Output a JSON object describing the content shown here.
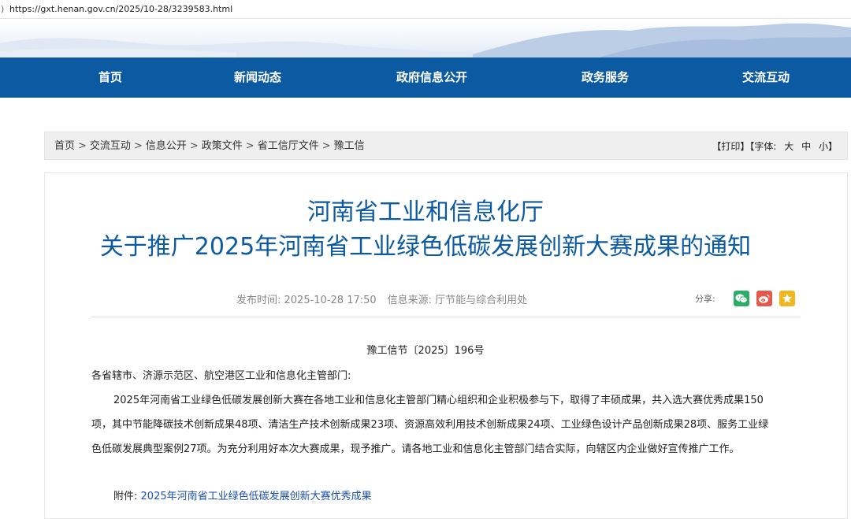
{
  "browser": {
    "url": "https://gxt.henan.gov.cn/2025/10-28/3239583.html"
  },
  "nav": {
    "items": [
      "首页",
      "新闻动态",
      "政府信息公开",
      "政务服务",
      "交流互动"
    ]
  },
  "breadcrumb": {
    "items": [
      "首页",
      "交流互动",
      "信息公开",
      "政策文件",
      "省工信厅文件",
      "豫工信"
    ],
    "separator": ">"
  },
  "tools": {
    "print_label": "【打印】",
    "font_label": "【字体:",
    "font_large": "大",
    "font_medium": "中",
    "font_small": "小",
    "font_close": "】"
  },
  "article": {
    "title_line1": "河南省工业和信息化厅",
    "title_line2": "关于推广2025年河南省工业绿色低碳发展创新大赛成果的通知",
    "publish_time": "发布时间: 2025-10-28 17:50",
    "source": "信息来源: 厅节能与综合利用处",
    "share_label": "分享:",
    "doc_number": "豫工信节〔2025〕196号",
    "addressee": "各省辖市、济源示范区、航空港区工业和信息化主管部门:",
    "paragraph_lines": [
      "2025年河南省工业绿色低碳发展创新大赛在各地工业和信息化主管部门精心组织和企业积极参与下，取得了丰硕成果，共入选大赛优秀成果150",
      "项，其中节能降碳技术创新成果48项、清洁生产技术创新成果23项、资源高效利用技术创新成果24项、工业绿色设计产品创新成果28项、服务工业绿",
      "色低碳发展典型案例27项。为充分利用好本次大赛成果，现予推广。请各地工业和信息化主管部门结合实际，向辖区内企业做好宣传推广工作。"
    ],
    "attachment_label": "附件:",
    "attachment_link": "2025年河南省工业绿色低碳发展创新大赛优秀成果"
  },
  "colors": {
    "nav_bg": "#0b5aa2",
    "title": "#0b5aa2",
    "link": "#1a4fa8",
    "wechat": "#2aae67",
    "weibo": "#e6584a",
    "favorite": "#f2b71f"
  },
  "icons": [
    "back-icon",
    "wechat-icon",
    "weibo-icon",
    "favorite-icon"
  ]
}
